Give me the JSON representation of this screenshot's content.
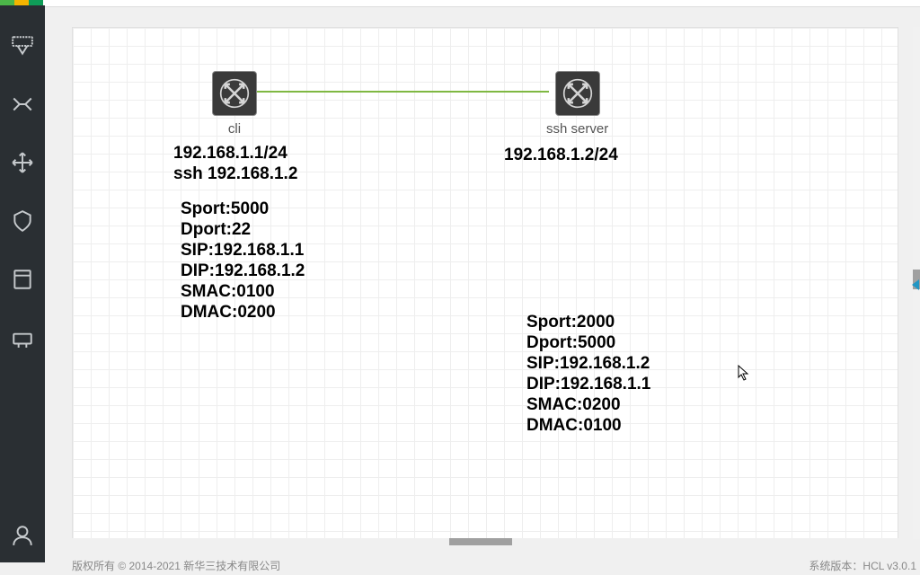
{
  "nodes": {
    "cli": {
      "label": "cli",
      "ip": "192.168.1.1/24",
      "cmd": "ssh 192.168.1.2"
    },
    "server": {
      "label": "ssh server",
      "ip": "192.168.1.2/24"
    }
  },
  "packets": {
    "left": {
      "sport": "Sport:5000",
      "dport": "Dport:22",
      "sip": "SIP:192.168.1.1",
      "dip": "DIP:192.168.1.2",
      "smac": "SMAC:0100",
      "dmac": "DMAC:0200"
    },
    "right": {
      "sport": "Sport:2000",
      "dport": "Dport:5000",
      "sip": "SIP:192.168.1.2",
      "dip": "DIP:192.168.1.1",
      "smac": "SMAC:0200",
      "dmac": "DMAC:0100"
    }
  },
  "footer": {
    "copyright": "版权所有 © 2014-2021 新华三技术有限公司",
    "version": "系统版本：HCL v3.0.1"
  }
}
